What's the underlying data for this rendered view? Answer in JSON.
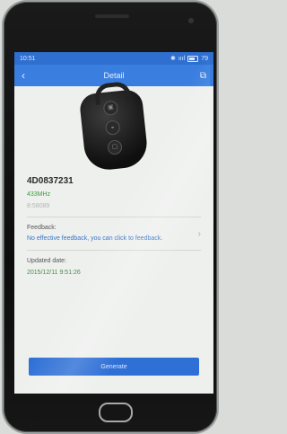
{
  "status_bar": {
    "time": "10:51",
    "signal": "ıııl",
    "battery_level": "79"
  },
  "title_bar": {
    "title": "Detail"
  },
  "key": {
    "part_number": "4D0837231",
    "frequency": "433MHz",
    "extra": "8:58089"
  },
  "feedback": {
    "label": "Feedback:",
    "text": "No effective feedback, you can click to feedback."
  },
  "updated": {
    "label": "Updated date:",
    "value": "2015/12/11 9:51:26"
  },
  "actions": {
    "generate_label": "Generate"
  }
}
